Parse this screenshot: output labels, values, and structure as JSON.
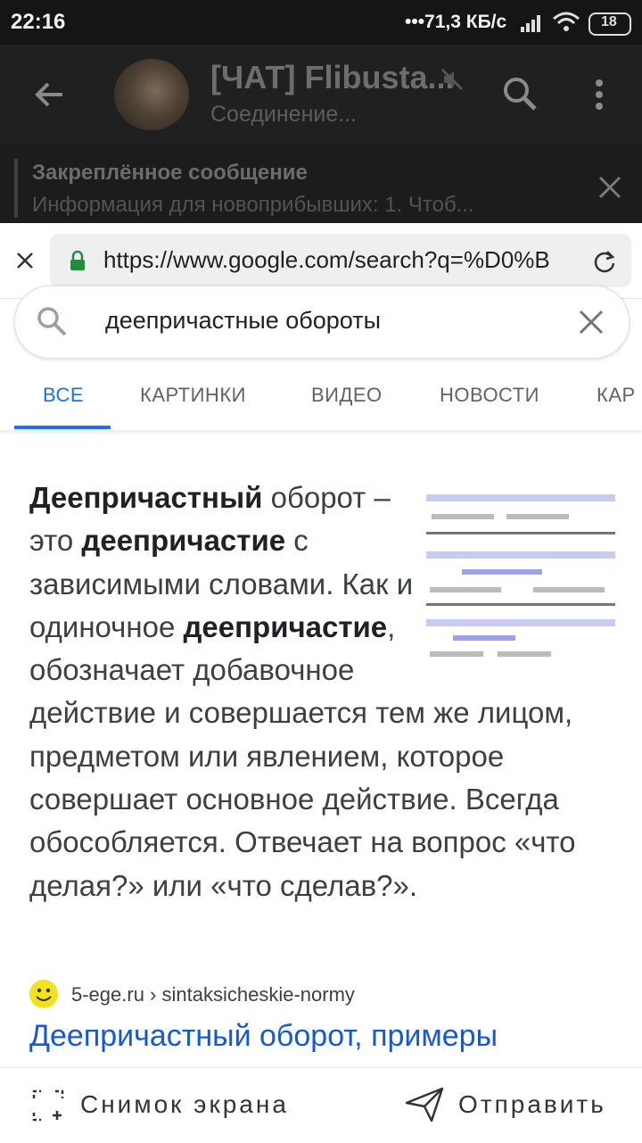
{
  "status_bar": {
    "time": "22:16",
    "network": "•••71,3 КБ/с",
    "battery": "18"
  },
  "telegram": {
    "chat_title": "[ЧАТ] Flibusta...",
    "chat_status": "Соединение...",
    "pinned_title": "Закреплённое сообщение",
    "pinned_text": "Информация для новоприбывших:  1. Чтоб..."
  },
  "browser": {
    "url": "https://www.google.com/search?q=%D0%B"
  },
  "google": {
    "query": "деепричастные обороты",
    "tabs": [
      {
        "label": "ВСЕ",
        "active": true
      },
      {
        "label": "КАРТИНКИ",
        "active": false
      },
      {
        "label": "ВИДЕО",
        "active": false
      },
      {
        "label": "НОВОСТИ",
        "active": false
      },
      {
        "label": "КАР",
        "active": false
      }
    ],
    "snippet": {
      "t1": "Деепричастный",
      "t2": " оборот – это ",
      "t3": "деепричастие",
      "t4": " с зависимыми словами. Как и одиночное ",
      "t5": "деепричастие",
      "t6": ", обозначает добавочное действие и совершается тем же лицом, предметом или явлением, которое совершает основное действие. Всегда обособляется. Отвечает на вопрос «что делая?» или «что сделав?»."
    },
    "source": {
      "site": "5-ege.ru › sintaksicheskie-normy"
    },
    "result_title": "Деепричастный оборот, примеры"
  },
  "bottom_bar": {
    "screenshot_label": "Снимок экрана",
    "send_label": "Отправить"
  },
  "colors": {
    "accent": "#1a73e8",
    "link": "#1558d6",
    "telegram_bg": "#1c1c1c"
  }
}
